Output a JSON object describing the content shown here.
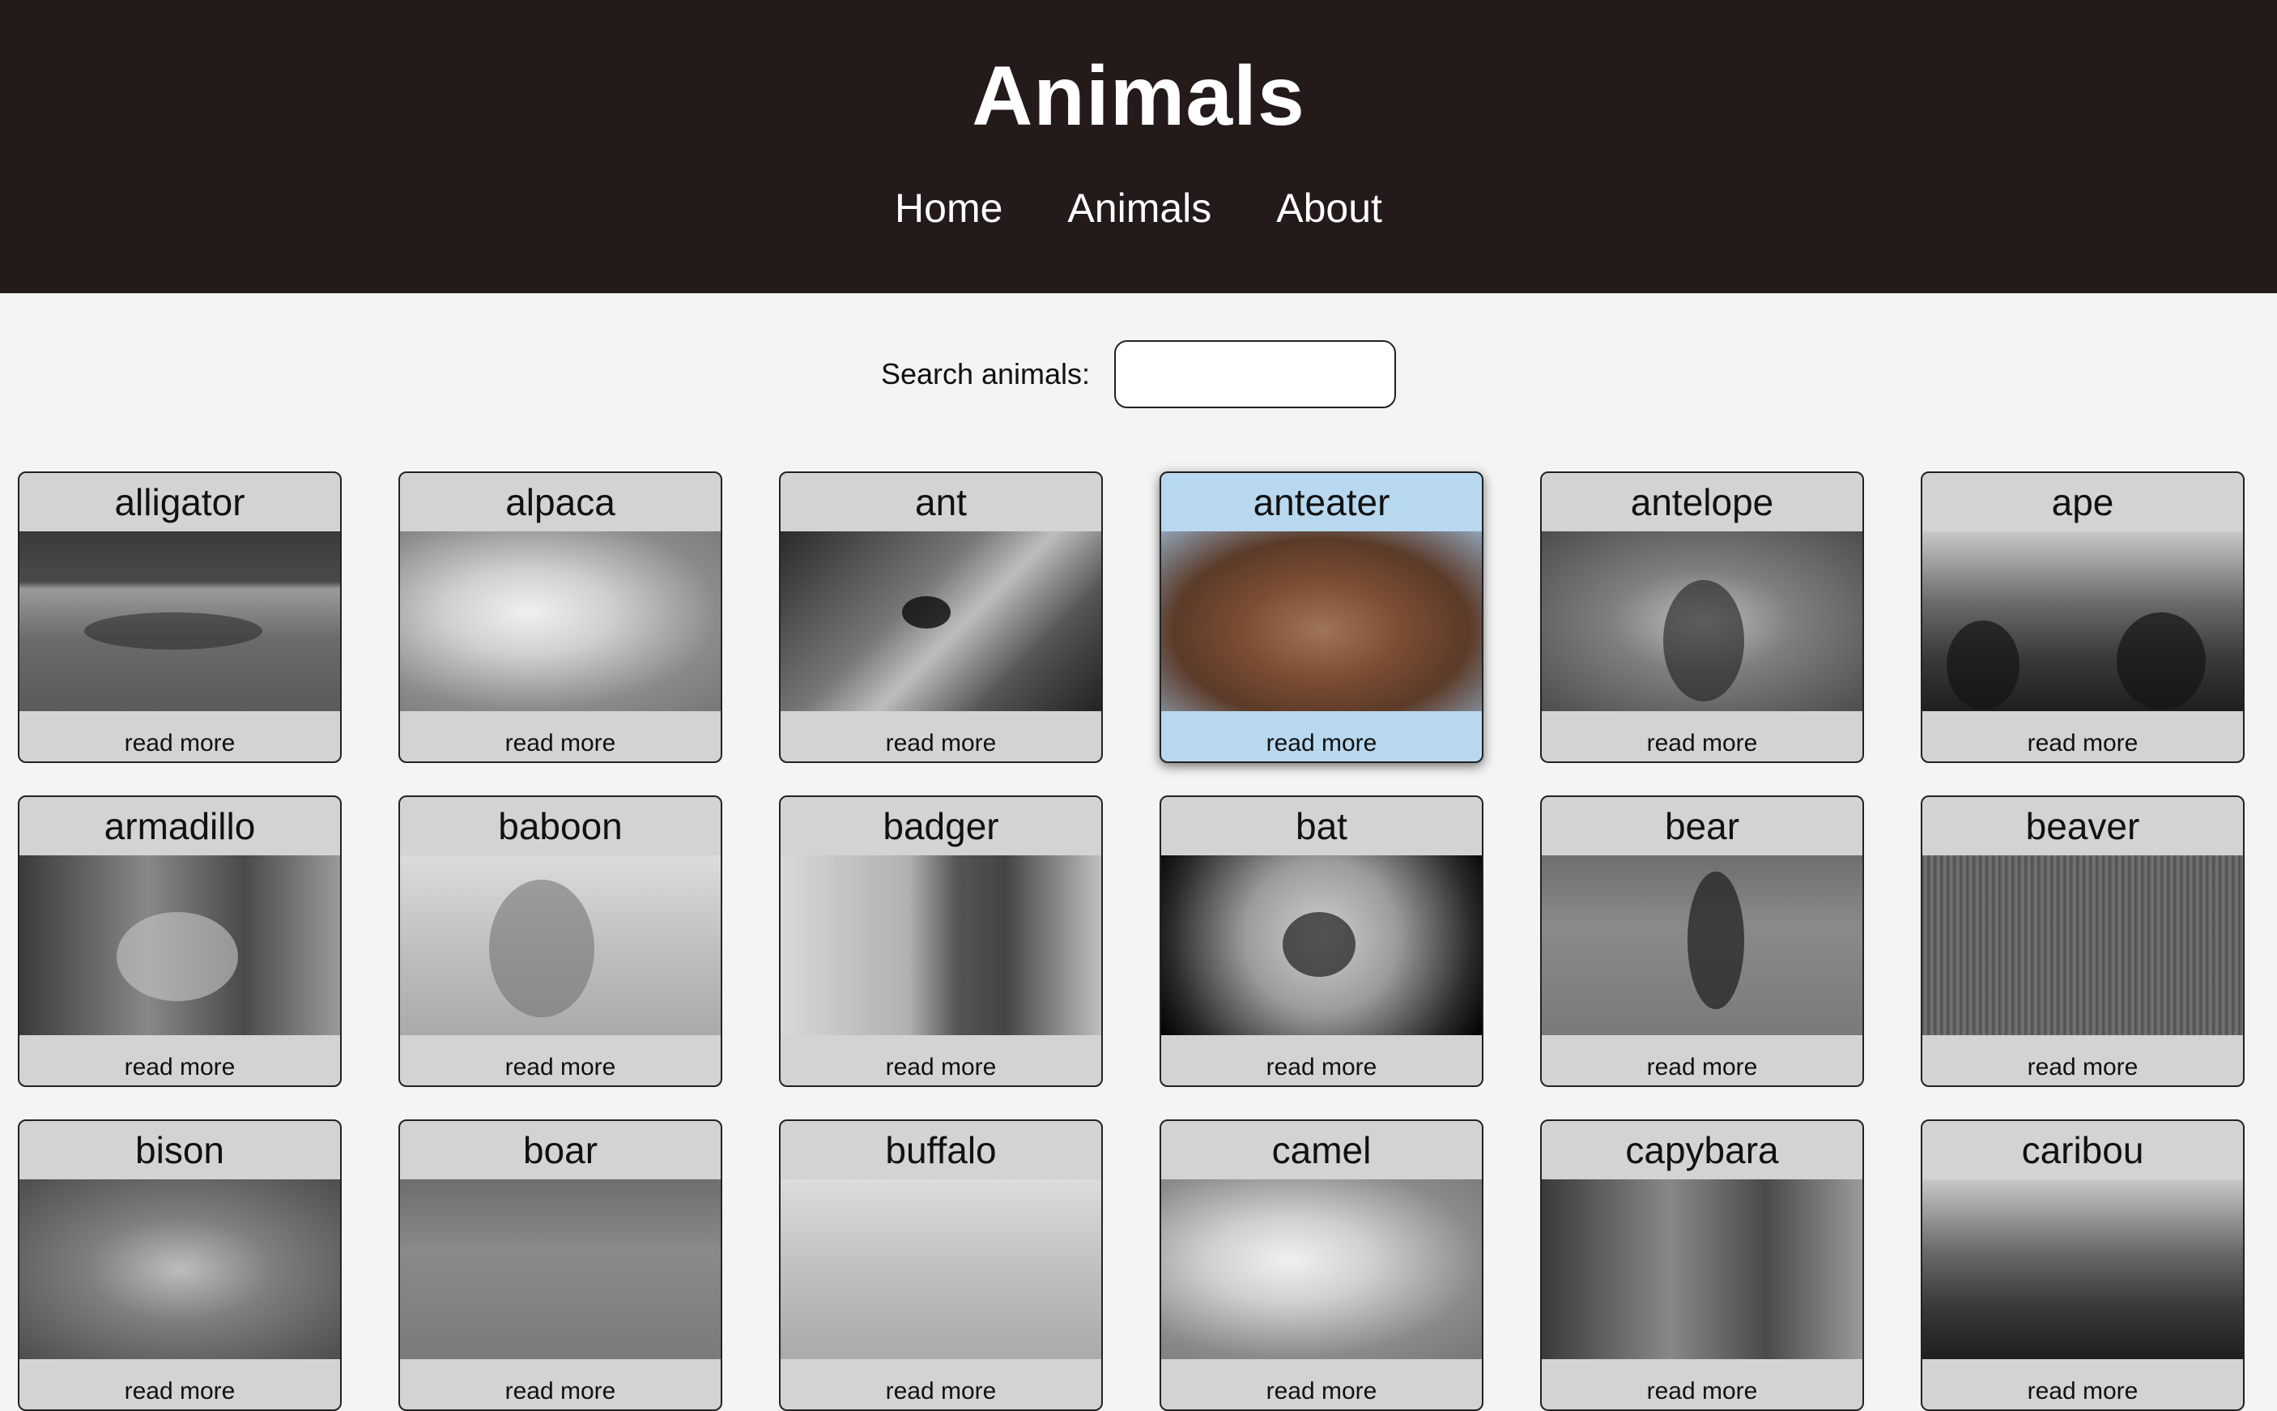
{
  "site": {
    "title": "Animals"
  },
  "nav": [
    {
      "label": "Home"
    },
    {
      "label": "Animals"
    },
    {
      "label": "About"
    }
  ],
  "search": {
    "label": "Search animals:",
    "value": "",
    "placeholder": ""
  },
  "cards": [
    {
      "name": "alligator",
      "more": "read more"
    },
    {
      "name": "alpaca",
      "more": "read more"
    },
    {
      "name": "ant",
      "more": "read more"
    },
    {
      "name": "anteater",
      "more": "read more"
    },
    {
      "name": "antelope",
      "more": "read more"
    },
    {
      "name": "ape",
      "more": "read more"
    },
    {
      "name": "armadillo",
      "more": "read more"
    },
    {
      "name": "baboon",
      "more": "read more"
    },
    {
      "name": "badger",
      "more": "read more"
    },
    {
      "name": "bat",
      "more": "read more"
    },
    {
      "name": "bear",
      "more": "read more"
    },
    {
      "name": "beaver",
      "more": "read more"
    },
    {
      "name": "bison",
      "more": "read more"
    },
    {
      "name": "boar",
      "more": "read more"
    },
    {
      "name": "buffalo",
      "more": "read more"
    },
    {
      "name": "camel",
      "more": "read more"
    },
    {
      "name": "capybara",
      "more": "read more"
    },
    {
      "name": "caribou",
      "more": "read more"
    }
  ],
  "colors": {
    "header_bg": "#241a1a",
    "card_bg": "#d3d3d3",
    "card_active_bg": "#b8d8ef",
    "page_bg": "#f4f4f4"
  }
}
